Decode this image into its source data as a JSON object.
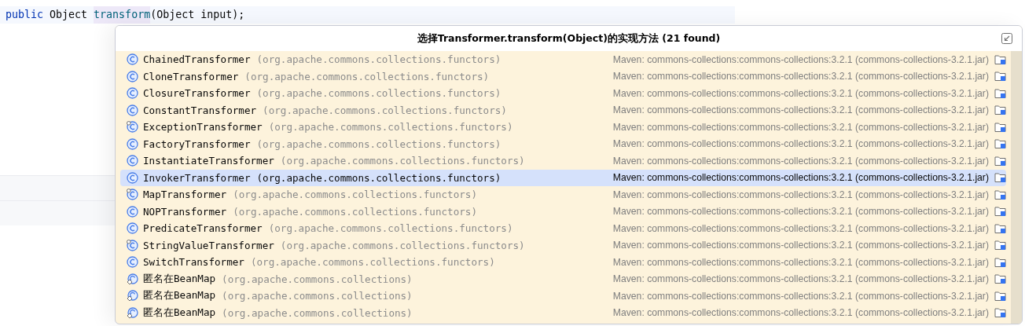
{
  "editor": {
    "code": [
      {
        "kind": "keyword",
        "text": "public"
      },
      {
        "kind": "plain",
        "text": " Object "
      },
      {
        "kind": "method",
        "text": "transform"
      },
      {
        "kind": "plain",
        "text": "(Object input);"
      }
    ]
  },
  "popup": {
    "title": "选择Transformer.transform(Object)的实现方法 (21 found)",
    "items": [
      {
        "kind": "class",
        "name": "ChainedTransformer",
        "package": "(org.apache.commons.collections.functors)",
        "location": "Maven: commons-collections:commons-collections:3.2.1 (commons-collections-3.2.1.jar)",
        "selected": false
      },
      {
        "kind": "class",
        "name": "CloneTransformer",
        "package": "(org.apache.commons.collections.functors)",
        "location": "Maven: commons-collections:commons-collections:3.2.1 (commons-collections-3.2.1.jar)",
        "selected": false
      },
      {
        "kind": "class",
        "name": "ClosureTransformer",
        "package": "(org.apache.commons.collections.functors)",
        "location": "Maven: commons-collections:commons-collections:3.2.1 (commons-collections-3.2.1.jar)",
        "selected": false
      },
      {
        "kind": "class",
        "name": "ConstantTransformer",
        "package": "(org.apache.commons.collections.functors)",
        "location": "Maven: commons-collections:commons-collections:3.2.1 (commons-collections-3.2.1.jar)",
        "selected": false
      },
      {
        "kind": "static-class",
        "name": "ExceptionTransformer",
        "package": "(org.apache.commons.collections.functors)",
        "location": "Maven: commons-collections:commons-collections:3.2.1 (commons-collections-3.2.1.jar)",
        "selected": false
      },
      {
        "kind": "class",
        "name": "FactoryTransformer",
        "package": "(org.apache.commons.collections.functors)",
        "location": "Maven: commons-collections:commons-collections:3.2.1 (commons-collections-3.2.1.jar)",
        "selected": false
      },
      {
        "kind": "class",
        "name": "InstantiateTransformer",
        "package": "(org.apache.commons.collections.functors)",
        "location": "Maven: commons-collections:commons-collections:3.2.1 (commons-collections-3.2.1.jar)",
        "selected": false
      },
      {
        "kind": "class",
        "name": "InvokerTransformer",
        "package": "(org.apache.commons.collections.functors)",
        "location": "Maven: commons-collections:commons-collections:3.2.1 (commons-collections-3.2.1.jar)",
        "selected": true
      },
      {
        "kind": "static-class",
        "name": "MapTransformer",
        "package": "(org.apache.commons.collections.functors)",
        "location": "Maven: commons-collections:commons-collections:3.2.1 (commons-collections-3.2.1.jar)",
        "selected": false
      },
      {
        "kind": "class",
        "name": "NOPTransformer",
        "package": "(org.apache.commons.collections.functors)",
        "location": "Maven: commons-collections:commons-collections:3.2.1 (commons-collections-3.2.1.jar)",
        "selected": false
      },
      {
        "kind": "class",
        "name": "PredicateTransformer",
        "package": "(org.apache.commons.collections.functors)",
        "location": "Maven: commons-collections:commons-collections:3.2.1 (commons-collections-3.2.1.jar)",
        "selected": false
      },
      {
        "kind": "static-class",
        "name": "StringValueTransformer",
        "package": "(org.apache.commons.collections.functors)",
        "location": "Maven: commons-collections:commons-collections:3.2.1 (commons-collections-3.2.1.jar)",
        "selected": false
      },
      {
        "kind": "class",
        "name": "SwitchTransformer",
        "package": "(org.apache.commons.collections.functors)",
        "location": "Maven: commons-collections:commons-collections:3.2.1 (commons-collections-3.2.1.jar)",
        "selected": false
      },
      {
        "kind": "anonymous",
        "name": "匿名在BeanMap",
        "package": "(org.apache.commons.collections)",
        "location": "Maven: commons-collections:commons-collections:3.2.1 (commons-collections-3.2.1.jar)",
        "selected": false
      },
      {
        "kind": "anonymous",
        "name": "匿名在BeanMap",
        "package": "(org.apache.commons.collections)",
        "location": "Maven: commons-collections:commons-collections:3.2.1 (commons-collections-3.2.1.jar)",
        "selected": false
      },
      {
        "kind": "anonymous",
        "name": "匿名在BeanMap",
        "package": "(org.apache.commons.collections)",
        "location": "Maven: commons-collections:commons-collections:3.2.1 (commons-collections-3.2.1.jar)",
        "selected": false
      }
    ]
  }
}
